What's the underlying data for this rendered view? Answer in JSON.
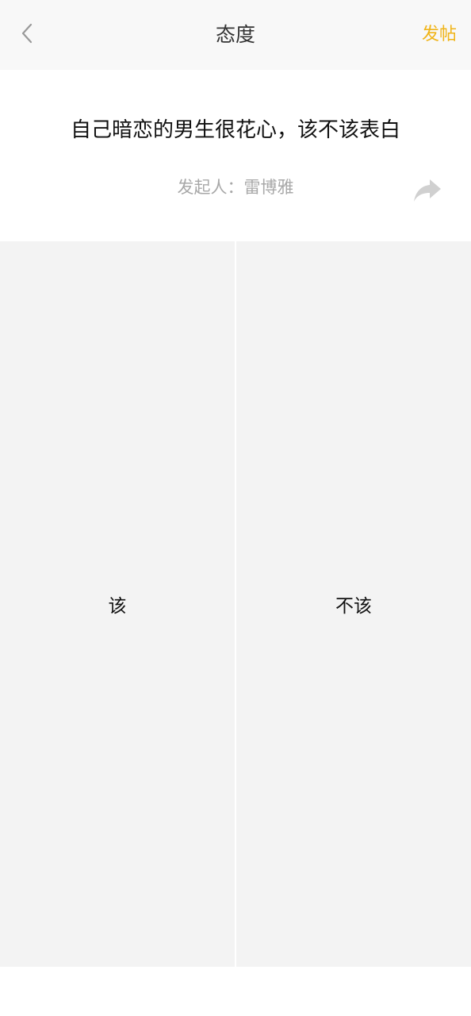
{
  "navbar": {
    "title": "态度",
    "post_label": "发帖",
    "back_icon": "chevron-left-icon"
  },
  "topic": {
    "question": "自己暗恋的男生很花心，该不该表白",
    "initiator": "发起人：雷博雅",
    "share_icon": "share-arrow-icon"
  },
  "options": [
    {
      "label": "该"
    },
    {
      "label": "不该"
    }
  ],
  "colors": {
    "accent": "#f0b418",
    "option_bg": "#f3f3f3",
    "navbar_bg": "#f8f8f8",
    "muted_text": "#a8a8a8"
  }
}
